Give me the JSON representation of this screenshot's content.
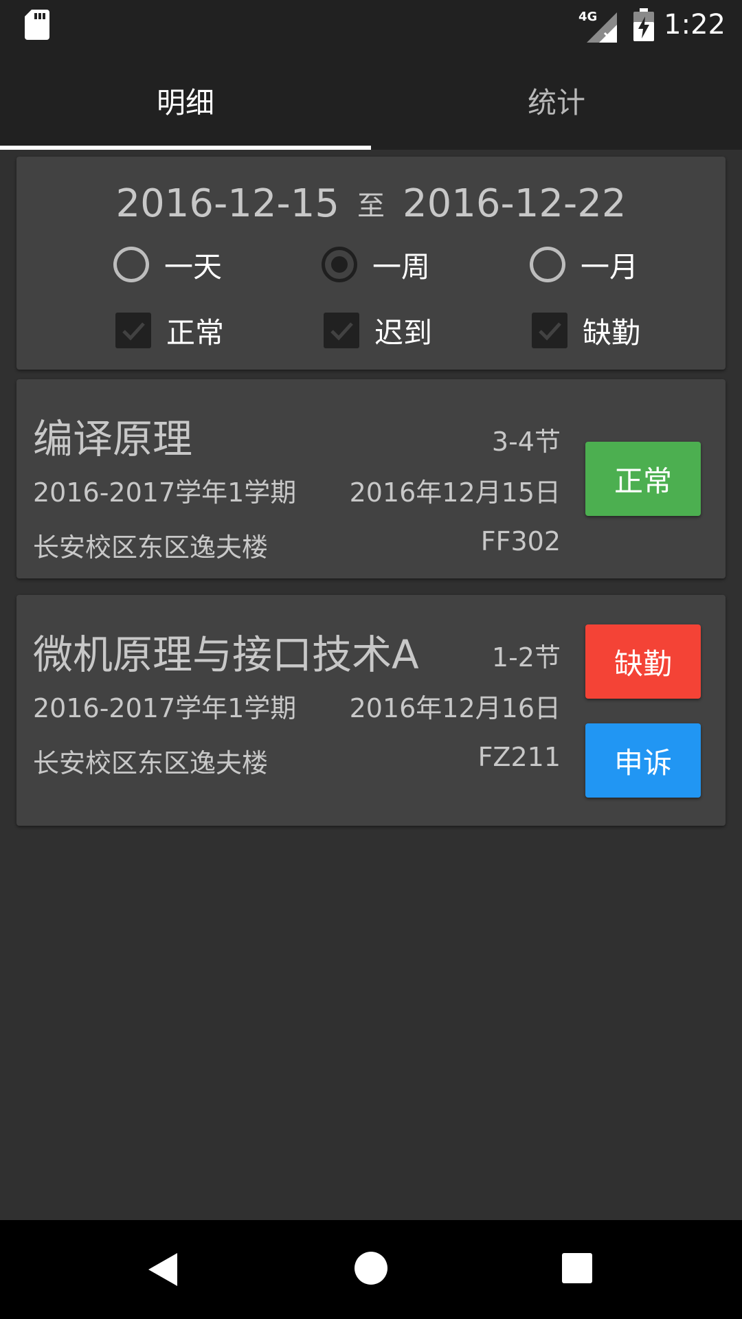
{
  "status_bar": {
    "network_label": "4G",
    "time": "1:22",
    "icons": [
      "sd-card-icon",
      "signal-4g-icon",
      "battery-charging-icon"
    ]
  },
  "tabs": [
    {
      "label": "明细",
      "active": true
    },
    {
      "label": "统计",
      "active": false
    }
  ],
  "filter": {
    "start_date": "2016-12-15",
    "separator": "至",
    "end_date": "2016-12-22",
    "periods": [
      {
        "label": "一天",
        "checked": false
      },
      {
        "label": "一周",
        "checked": true
      },
      {
        "label": "一月",
        "checked": false
      }
    ],
    "statuses": [
      {
        "label": "正常",
        "checked": true
      },
      {
        "label": "迟到",
        "checked": true
      },
      {
        "label": "缺勤",
        "checked": true
      }
    ]
  },
  "records": [
    {
      "course": "编译原理",
      "section": "3-4节",
      "term": "2016-2017学年1学期",
      "date": "2016年12月15日",
      "location": "长安校区东区逸夫楼",
      "room": "FF302",
      "status_label": "正常",
      "status_color": "#4caf50"
    },
    {
      "course": "微机原理与接口技术A",
      "section": "1-2节",
      "term": "2016-2017学年1学期",
      "date": "2016年12月16日",
      "location": "长安校区东区逸夫楼",
      "room": "FZ211",
      "status_label": "缺勤",
      "status_color": "#f44336",
      "appeal_label": "申诉",
      "appeal_color": "#2196f3"
    }
  ],
  "colors": {
    "background": "#303030",
    "card": "#424242",
    "bars": "#212121"
  }
}
